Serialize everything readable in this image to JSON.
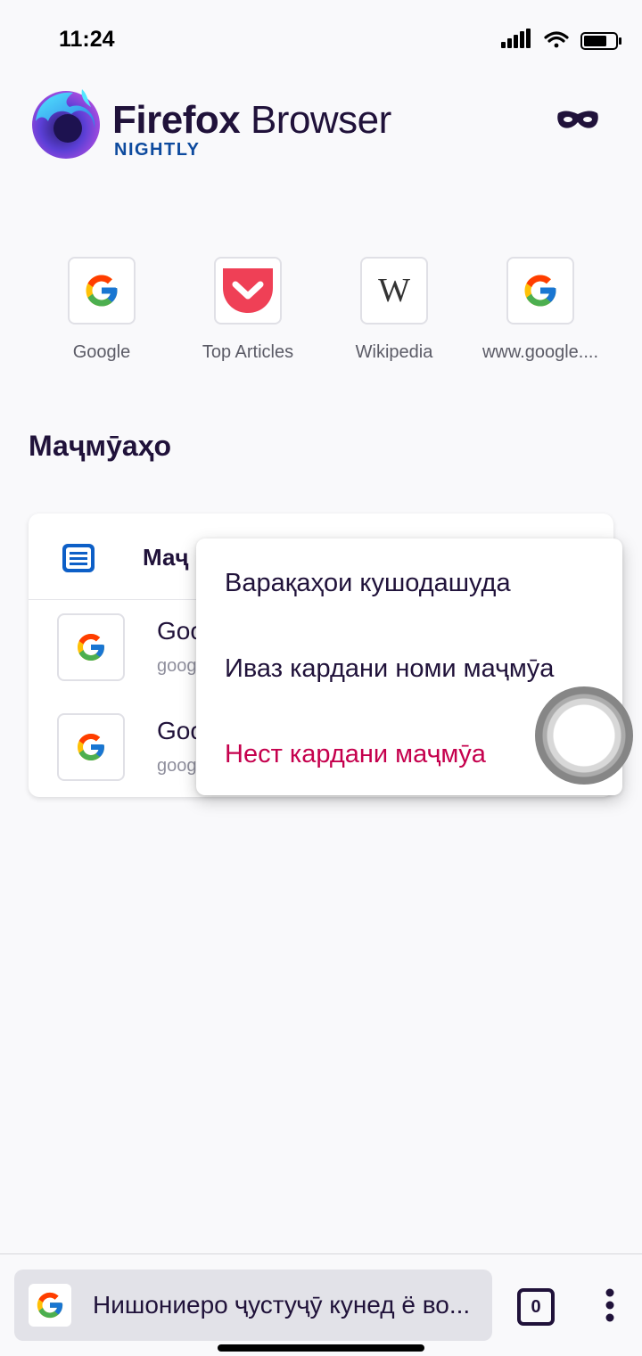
{
  "status_bar": {
    "time": "11:24"
  },
  "header": {
    "brand_bold": "Firefox",
    "brand_light": "Browser",
    "edition": "NIGHTLY",
    "private_mode_icon": "mask-icon"
  },
  "top_sites": [
    {
      "label": "Google",
      "icon": "google-g-icon"
    },
    {
      "label": "Top Articles",
      "icon": "pocket-icon"
    },
    {
      "label": "Wikipedia",
      "icon": "wikipedia-w-icon"
    },
    {
      "label": "www.google....",
      "icon": "google-g-icon"
    }
  ],
  "collections": {
    "heading": "Маҷмӯаҳо",
    "card": {
      "name": "Маҷ",
      "icon": "collection-icon",
      "tabs": [
        {
          "title": "Goo",
          "url": "goog"
        },
        {
          "title": "Goo",
          "url": "goog"
        }
      ]
    }
  },
  "popup_menu": {
    "items": [
      {
        "label": "Варақаҳои кушодашуда"
      },
      {
        "label": "Иваз кардани номи маҷмӯа"
      },
      {
        "label": "Нест кардани маҷмӯа"
      }
    ],
    "delete_color": "#c5004d"
  },
  "bottom_bar": {
    "search_placeholder": "Нишониеро ҷустуҷӯ кунед ё во...",
    "tab_count": "0",
    "engine_icon": "google-g-icon"
  },
  "colors": {
    "text": "#20123a",
    "accent": "#0d4a9e",
    "background": "#f9f9fb"
  }
}
